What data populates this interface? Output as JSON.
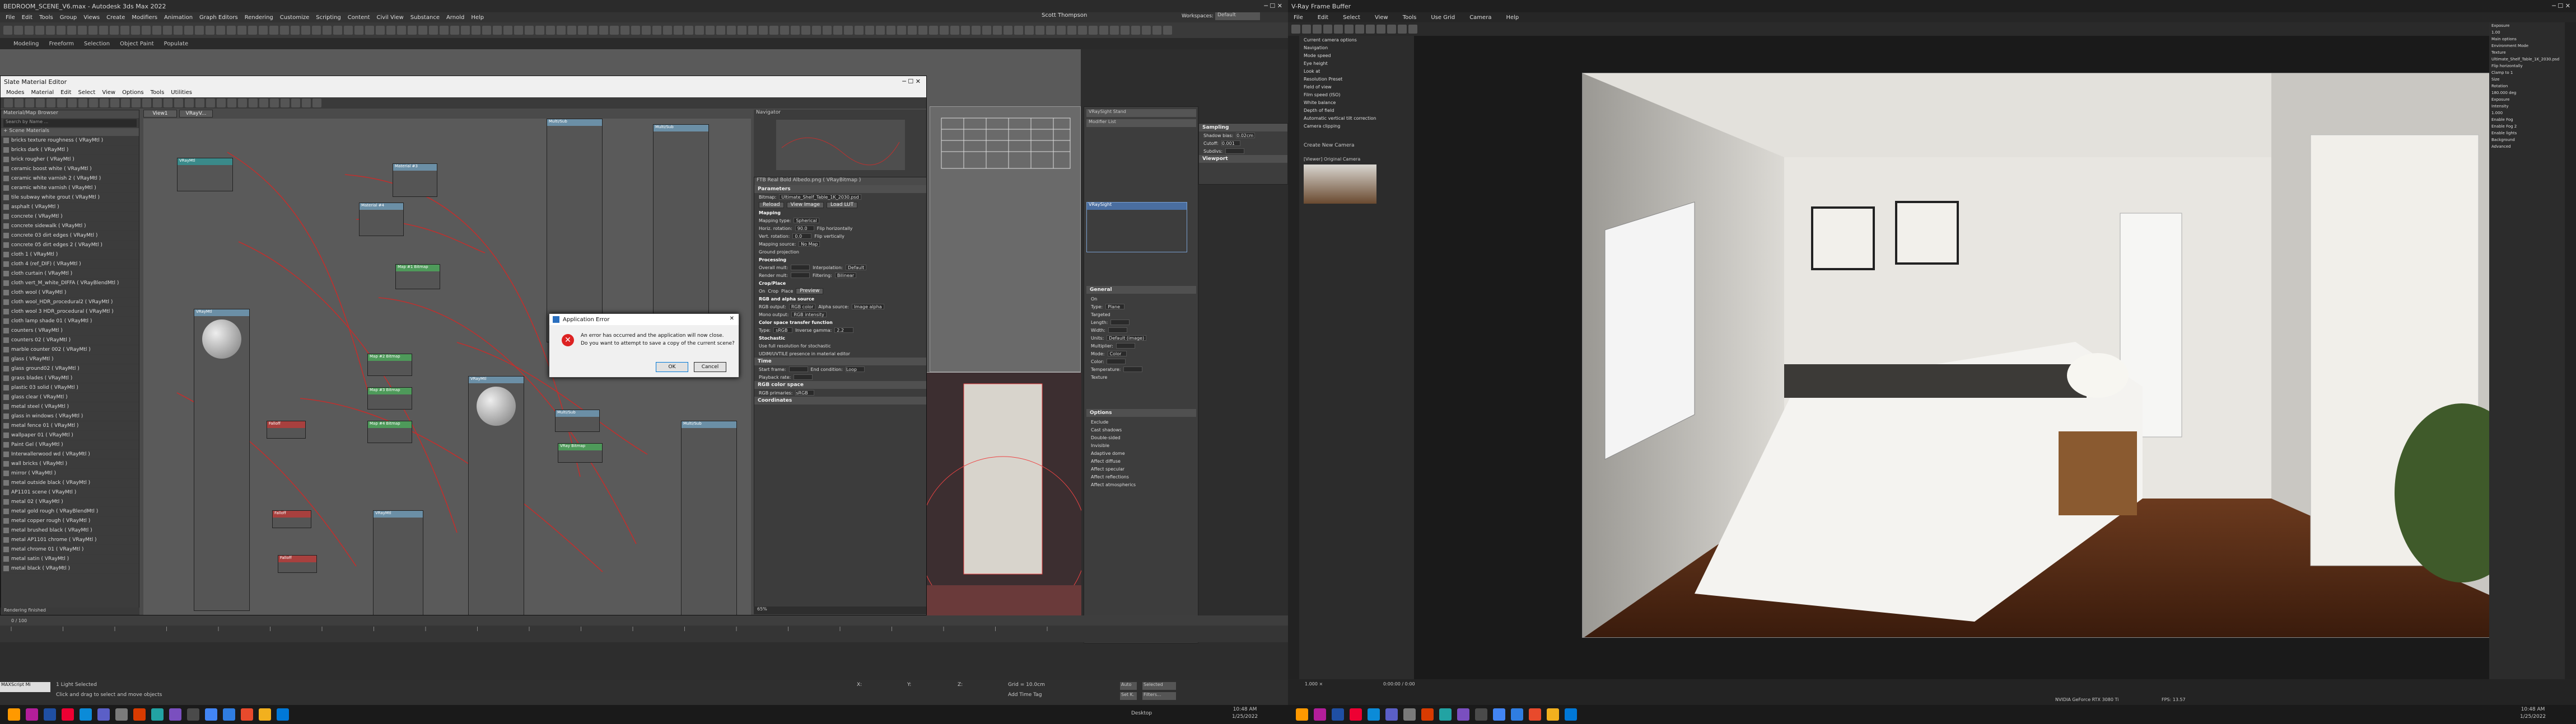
{
  "max": {
    "title": "BEDROOM_SCENE_V6.max - Autodesk 3ds Max 2022",
    "menus": [
      "File",
      "Edit",
      "Tools",
      "Group",
      "Views",
      "Create",
      "Modifiers",
      "Animation",
      "Graph Editors",
      "Rendering",
      "Customize",
      "Scripting",
      "Content",
      "Civil View",
      "Substance",
      "Arnold",
      "Help"
    ],
    "user": "Scott Thompson",
    "workspace_label": "Workspaces:",
    "workspace_value": "Default",
    "ribbon_tabs": [
      "Modeling",
      "Freeform",
      "Selection",
      "Object Paint",
      "Populate"
    ],
    "slate": {
      "title": "Slate Material Editor",
      "menus": [
        "Modes",
        "Material",
        "Edit",
        "Select",
        "View",
        "Options",
        "Tools",
        "Utilities"
      ],
      "browser_title": "Material/Map Browser",
      "browser_search": "Search by Name ...",
      "group_label": "+ Scene Materials",
      "materials": [
        "bricks texture roughness  ( VRayMtl )",
        "bricks dark  ( VRayMtl )",
        "brick rougher  ( VRayMtl )",
        "ceramic boost white  ( VRayMtl )",
        "ceramic white varnish 2  ( VRayMtl )",
        "ceramic white varnish  ( VRayMtl )",
        "tile subway white grout  ( VRayMtl )",
        "asphalt  ( VRayMtl )",
        "concrete  ( VRayMtl )",
        "concrete  sidewalk  ( VRayMtl )",
        "concrete 03 dirt edges  ( VRayMtl )",
        "concrete 05 dirt edges 2  ( VRayMtl )",
        "cloth 1  ( VRayMtl )",
        "cloth 4 (ref_DIF)  ( VRayMtl )",
        "cloth curtain  ( VRayMtl )",
        "cloth vert_M_white_DIFFA  ( VRayBlendMtl )",
        "cloth wool  ( VRayMtl )",
        "cloth wool_HDR_procedural2  ( VRayMtl )",
        "cloth wool 3 HDR_procedural  ( VRayMtl )",
        "cloth lamp shade 01  ( VRayMtl )",
        "counters  ( VRayMtl )",
        "counters 02  ( VRayMtl )",
        "marble counter 002  ( VRayMtl )",
        "glass  ( VRayMtl )",
        "glass ground02  ( VRayMtl )",
        "grass blades  ( VRayMtl )",
        "plastic 03 solid  ( VRayMtl )",
        "glass clear  ( VRayMtl )",
        "metal steel  ( VRayMtl )",
        "glass in windows  ( VRayMtl )",
        "metal fence 01  ( VRayMtl )",
        "wallpaper 01  ( VRayMtl )",
        "Paint Gel  ( VRayMtl )",
        "Interwallerwood wd  ( VRayMtl )",
        "wall bricks  ( VRayMtl )",
        "mirror  ( VRayMtl )",
        "metal outside black  ( VRayMtl )",
        "AP1101 scene  ( VRayMtl )",
        "metal 02  ( VRayMtl )",
        "metal gold rough  ( VRayBlendMtl )",
        "metal copper rough  ( VRayMtl )",
        "metal brushed black  ( VRayMtl )",
        "metal AP1101 chrome  ( VRayMtl )",
        "metal chrome 01  ( VRayMtl )",
        "metal satin  ( VRayMtl )",
        "metal black  ( VRayMtl )"
      ],
      "view_tabs": [
        "View1",
        "VRayV..."
      ],
      "navigator_label": "Navigator",
      "rendering_label": "Rendering finished",
      "params_title": "Bitmap Parameters",
      "params_header": "FTB Real Bold Albedo.png  ( VRayBitmap )",
      "rollouts": {
        "parameters": "Parameters",
        "bitmap_label": "Bitmap:",
        "bitmap_value": "Ultimate_Shelf_Table_1K_2030.psd",
        "reload": "Reload",
        "view_image": "View Image",
        "load_lut": "Load LUT",
        "mapping": "Mapping",
        "mapping_type_label": "Mapping type:",
        "mapping_type_value": "Spherical",
        "horiz_rotation": "Horiz. rotation:",
        "horiz_val": "90.0",
        "flip_h": "Flip horizontally",
        "vert_rotation": "Vert. rotation:",
        "vert_val": "0.0",
        "flip_v": "Flip vertically",
        "mapping_source": "Mapping source:",
        "no_map": "No Map",
        "ground_proj": "Ground projection",
        "processing": "Processing",
        "overall_mult": "Overall mult:",
        "render_mult": "Render mult:",
        "interpolation": "Interpolation:",
        "interp_value": "Default",
        "filtering": "Filtering:",
        "filter_value": "Bilinear",
        "crop_place": "Crop/Place",
        "on": "On",
        "crop": "Crop",
        "place": "Place",
        "preview": "Preview",
        "rgb_alpha": "RGB and alpha source",
        "rgb_output": "RGB output:",
        "rgb_output_val": "RGB color",
        "alpha_source": "Alpha source:",
        "alpha_source_val": "Image alpha",
        "mono_output": "Mono output:",
        "mono_val": "RGB intensity",
        "color_space": "Color space transfer function",
        "type_label": "Type:",
        "type_val": "sRGB",
        "inverse_gamma": "Inverse gamma:",
        "inverse_val": "2.2",
        "stochastic": "Stochastic",
        "use_full_res": "Use full resolution for stochastic",
        "udim": "UDIM/UVTILE presence in material editor",
        "time": "Time",
        "start_frame": "Start frame:",
        "playback_rate": "Playback rate:",
        "end_condition": "End condition:",
        "end_cond_val": "Loop",
        "rgb_color_space": "RGB color space",
        "rgb_primaries": "RGB primaries:",
        "rgb_primaries_val": "sRGB",
        "coordinates": "Coordinates"
      },
      "zoom_value": "65%"
    },
    "error_dialog": {
      "title": "Application Error",
      "message_1": "An error has occurred and the application will now close.",
      "message_2": "Do you want to attempt to save a copy of the current scene?",
      "ok": "OK",
      "cancel": "Cancel"
    },
    "command_panel": {
      "dropdown_1": "VRaySight Stand",
      "dropdown_2": "Modifier List",
      "list_item": "VRaySight",
      "sampling": "Sampling",
      "shadow_bias": "Shadow bias:",
      "shadow_bias_val": "0.02cm",
      "cutoff": "Cutoff:",
      "cutoff_val": "0.001",
      "subdivs": "Subdivs:",
      "viewport": "Viewport",
      "general": "General",
      "on": "On",
      "type": "Type:",
      "type_val": "Plane",
      "targeted": "Targeted",
      "length": "Length:",
      "width": "Width:",
      "units": "Units:",
      "units_val": "Default (image)",
      "multiplier": "Multiplier:",
      "mode": "Mode:",
      "mode_val": "Color",
      "color": "Color:",
      "temperature": "Temperature:",
      "texture": "Texture",
      "options": "Options",
      "exclude": "Exclude",
      "cast_shadows": "Cast shadows",
      "double_sided": "Double-sided",
      "invisible": "Invisible",
      "affect_diffuse": "Affect diffuse",
      "affect_specular": "Affect specular",
      "affect_reflections": "Affect reflections",
      "affect_atmos": "Affect atmospherics",
      "adaptive_dome": "Adaptive dome"
    },
    "status": {
      "selected": "1 Light Selected",
      "prompt": "Click and drag to select and move objects",
      "frame": "0 / 100",
      "x_label": "X:",
      "y_label": "Y:",
      "z_label": "Z:",
      "grid": "Grid = 10.0cm",
      "add_time_tag": "Add Time Tag",
      "auto": "Auto",
      "selected_dropdown": "Selected",
      "set_k": "Set K.",
      "filters": "Filters...",
      "maxscript": "MAXScript Mi"
    }
  },
  "vfb": {
    "title": "V-Ray Frame Buffer",
    "menus": [
      "File",
      "Edit",
      "Select",
      "View",
      "Tools",
      "Use Grid",
      "Camera",
      "Help"
    ],
    "sidebar_items": [
      "Current camera options",
      "Navigation",
      "Mode speed",
      "Eye height",
      "Look at",
      "Resolution Preset",
      "Field of view",
      "Film speed (ISO)",
      "White balance",
      "Depth of field",
      "Automatic vertical tilt correction",
      "Camera clipping"
    ],
    "create_camera": "Create New Camera",
    "thumb_label": "[Viewer] Original Camera",
    "right_panel": {
      "exposure": "Exposure",
      "exposure_val": "1.00",
      "main_options": "Main options",
      "environment_mode": "Environment Mode",
      "env_mode_val": "Texture",
      "env_map": "Ultimate_Shelf_Table_1K_2030.psd",
      "flip_horizontally": "Flip horizontally",
      "clamp_to": "Clamp to 1",
      "light_size": "Size",
      "rotation": "Rotation",
      "rotation_val": "180.000 deg",
      "exposure_comp": "Exposure",
      "intensity": "Intensity",
      "intensity_val": "1.000",
      "enable_fog": "Enable Fog",
      "enable_fog2": "Enable Fog 2",
      "enable_lights": "Enable lights",
      "background": "Background",
      "advanced": "Advanced"
    },
    "status_left": "1.000 ×",
    "status_mid": "0:00:00 / 0:00",
    "status_right": "NVIDIA GeForce RTX 3080 Ti",
    "status_render": "FPS: 13.57"
  },
  "taskbar": {
    "left_time": "10:48 AM",
    "left_date": "1/25/2022",
    "right_time": "10:48 AM",
    "right_date": "1/25/2022",
    "desktop": "Desktop"
  }
}
